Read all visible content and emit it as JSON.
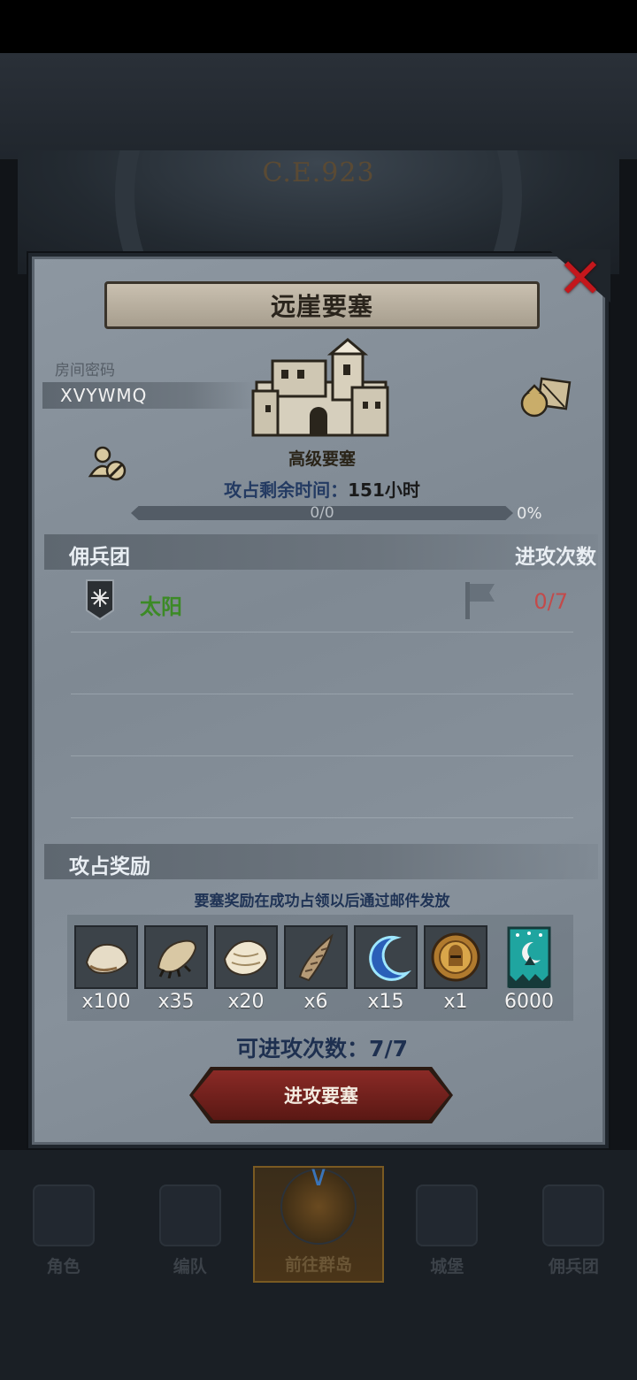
{
  "background": {
    "year_label": "C.E.923"
  },
  "panel": {
    "title": "远崖要塞",
    "room_label": "房间密码",
    "room_code": "XVYWMQ",
    "fortress_level": "高级要塞",
    "time_label": "攻占剩余时间：",
    "time_value": "151小时",
    "progress_text": "0/0",
    "progress_percent": "0%",
    "progress_fraction": 0,
    "mercenary_header": "佣兵团",
    "attack_count_header": "进攻次数",
    "guild": {
      "name": "太阳",
      "attacks": "0/7",
      "name_color": "#3c8a26",
      "attacks_color": "#c34a4a"
    },
    "reward_header": "攻占奖励",
    "reward_note": "要塞奖励在成功占领以后通过邮件发放",
    "rewards": [
      {
        "icon": "hide-pelt-icon",
        "qty": "x100"
      },
      {
        "icon": "claw-icon",
        "qty": "x35"
      },
      {
        "icon": "fur-icon",
        "qty": "x20"
      },
      {
        "icon": "horn-icon",
        "qty": "x6"
      },
      {
        "icon": "crescent-blade-icon",
        "qty": "x15"
      },
      {
        "icon": "knight-medal-icon",
        "qty": "x1"
      },
      {
        "icon": "banner-icon",
        "qty": "6000"
      }
    ],
    "attacks_available_label": "可进攻次数：",
    "attacks_available_value": "7/7",
    "attack_button": "进攻要塞"
  },
  "nav": {
    "items": [
      {
        "label": "角色",
        "icon": "knight-icon"
      },
      {
        "label": "编队",
        "icon": "helmet-icon"
      },
      {
        "label": "前往群岛",
        "icon": "island-globe-icon"
      },
      {
        "label": "城堡",
        "icon": "castle-icon"
      },
      {
        "label": "佣兵团",
        "icon": "ship-icon"
      }
    ]
  }
}
